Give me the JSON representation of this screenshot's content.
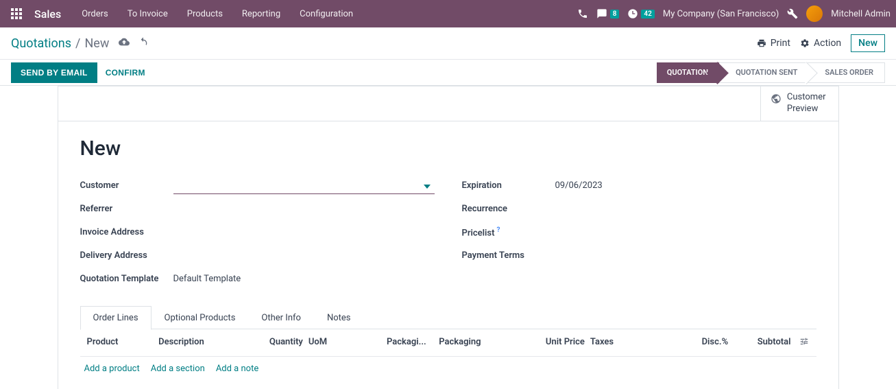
{
  "navbar": {
    "app_name": "Sales",
    "links": [
      "Orders",
      "To Invoice",
      "Products",
      "Reporting",
      "Configuration"
    ],
    "messages_count": "8",
    "activities_count": "42",
    "company": "My Company (San Francisco)",
    "user": "Mitchell Admin"
  },
  "breadcrumb": {
    "root": "Quotations",
    "current": "New"
  },
  "actions": {
    "print": "Print",
    "action": "Action",
    "new": "New"
  },
  "buttons": {
    "send_email": "SEND BY EMAIL",
    "confirm": "CONFIRM"
  },
  "status_steps": [
    "QUOTATION",
    "QUOTATION SENT",
    "SALES ORDER"
  ],
  "customer_preview": {
    "line1": "Customer",
    "line2": "Preview"
  },
  "form": {
    "title": "New",
    "left": {
      "customer_label": "Customer",
      "referrer_label": "Referrer",
      "invoice_addr_label": "Invoice Address",
      "delivery_addr_label": "Delivery Address",
      "template_label": "Quotation Template",
      "template_value": "Default Template"
    },
    "right": {
      "expiration_label": "Expiration",
      "expiration_value": "09/06/2023",
      "recurrence_label": "Recurrence",
      "pricelist_label": "Pricelist",
      "payment_terms_label": "Payment Terms"
    }
  },
  "tabs": [
    "Order Lines",
    "Optional Products",
    "Other Info",
    "Notes"
  ],
  "table": {
    "headers": {
      "product": "Product",
      "description": "Description",
      "quantity": "Quantity",
      "uom": "UoM",
      "packaging1": "Packagi...",
      "packaging2": "Packaging",
      "unit_price": "Unit Price",
      "taxes": "Taxes",
      "disc": "Disc.%",
      "subtotal": "Subtotal"
    },
    "add_links": {
      "product": "Add a product",
      "section": "Add a section",
      "note": "Add a note"
    }
  }
}
